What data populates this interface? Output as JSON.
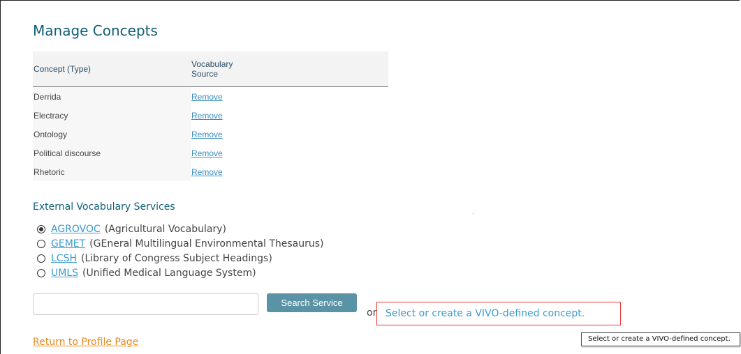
{
  "page": {
    "title": "Manage Concepts"
  },
  "table": {
    "headers": {
      "concept": "Concept (Type)",
      "vocabulary": "Vocabulary Source"
    },
    "rows": [
      {
        "concept": "Derrida",
        "action": "Remove"
      },
      {
        "concept": "Electracy",
        "action": "Remove"
      },
      {
        "concept": "Ontology",
        "action": "Remove"
      },
      {
        "concept": "Political discourse",
        "action": "Remove"
      },
      {
        "concept": "Rhetoric",
        "action": "Remove"
      }
    ]
  },
  "external": {
    "title": "External Vocabulary Services",
    "services": [
      {
        "abbr": "AGROVOC",
        "full": "(Agricultural Vocabulary)",
        "selected": true
      },
      {
        "abbr": "GEMET",
        "full": "(GEneral Multilingual Environmental Thesaurus)",
        "selected": false
      },
      {
        "abbr": "LCSH",
        "full": "(Library of Congress Subject Headings)",
        "selected": false
      },
      {
        "abbr": "UMLS",
        "full": "(Unified Medical Language System)",
        "selected": false
      }
    ]
  },
  "search": {
    "value": "",
    "button_label": "Search Service",
    "or_text": "or",
    "vivo_link": "Select or create a VIVO-defined concept."
  },
  "footer": {
    "return_link": "Return to Profile Page"
  },
  "tooltip": {
    "text": "Select or create a VIVO-defined concept."
  }
}
